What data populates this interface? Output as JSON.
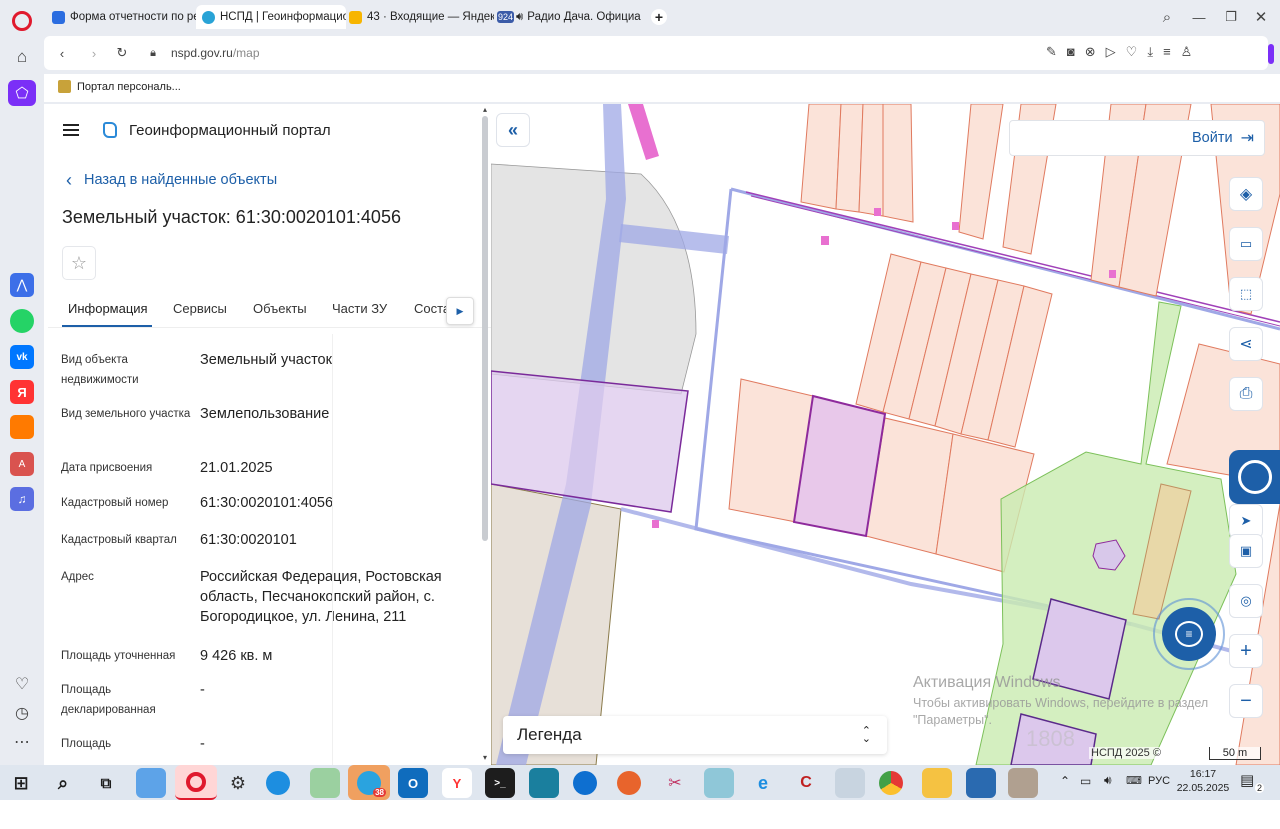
{
  "browser": {
    "tabs": [
      {
        "title": "Форма отчетности по ре"
      },
      {
        "title": "НСПД | Геоинформацион"
      },
      {
        "title": "43 · Входящие — Яндекс"
      },
      {
        "title": "Радио Дача. Официа"
      }
    ],
    "tab3_badge": "924",
    "url_host": "nspd.gov.ru",
    "url_path": "/map",
    "bookmark": "Портал персональ..."
  },
  "panel": {
    "portal_title": "Геоинформационный портал",
    "back_link": "Назад в найденные объекты",
    "object_title": "Земельный участок: 61:30:0020101:4056",
    "tabs": [
      "Информация",
      "Сервисы",
      "Объекты",
      "Части ЗУ",
      "Соста"
    ],
    "rows": [
      {
        "label": "Вид объекта недвижимости",
        "value": "Земельный участок"
      },
      {
        "label": "Вид земельного участка",
        "value": "Землепользование"
      },
      {
        "label": "Дата присвоения",
        "value": "21.01.2025"
      },
      {
        "label": "Кадастровый номер",
        "value": "61:30:0020101:4056"
      },
      {
        "label": "Кадастровый квартал",
        "value": "61:30:0020101"
      },
      {
        "label": "Адрес",
        "value": "Российская Федерация, Ростовская область, Песчанокопский район, с. Богородицкое, ул. Ленина, 211"
      },
      {
        "label": "Площадь уточненная",
        "value": "9 426 кв. м"
      },
      {
        "label": "Площадь декларированная",
        "value": "-"
      },
      {
        "label": "Площадь",
        "value": "-"
      }
    ]
  },
  "map": {
    "login": "Войти",
    "legend": "Легенда",
    "copyright": "НСПД 2025 ©",
    "scale": "50 m",
    "watermark_title": "Активация Windows",
    "watermark_text": "Чтобы активировать Windows, перейдите в раздел \"Параметры\".",
    "faint_label": "1808"
  },
  "taskbar": {
    "lang": "РУС",
    "time": "16:17",
    "date": "22.05.2025",
    "notif_count": "2",
    "telegram_badge": "38"
  },
  "colors": {
    "accent": "#1d5fa8",
    "parcel_fill": "#fbe3d9",
    "parcel_stroke": "#e07a5f",
    "selected_fill": "#e8c8ea",
    "selected_stroke": "#8e2a9c",
    "green_zone": "#c9ebb0",
    "road": "#9fa8e6"
  }
}
